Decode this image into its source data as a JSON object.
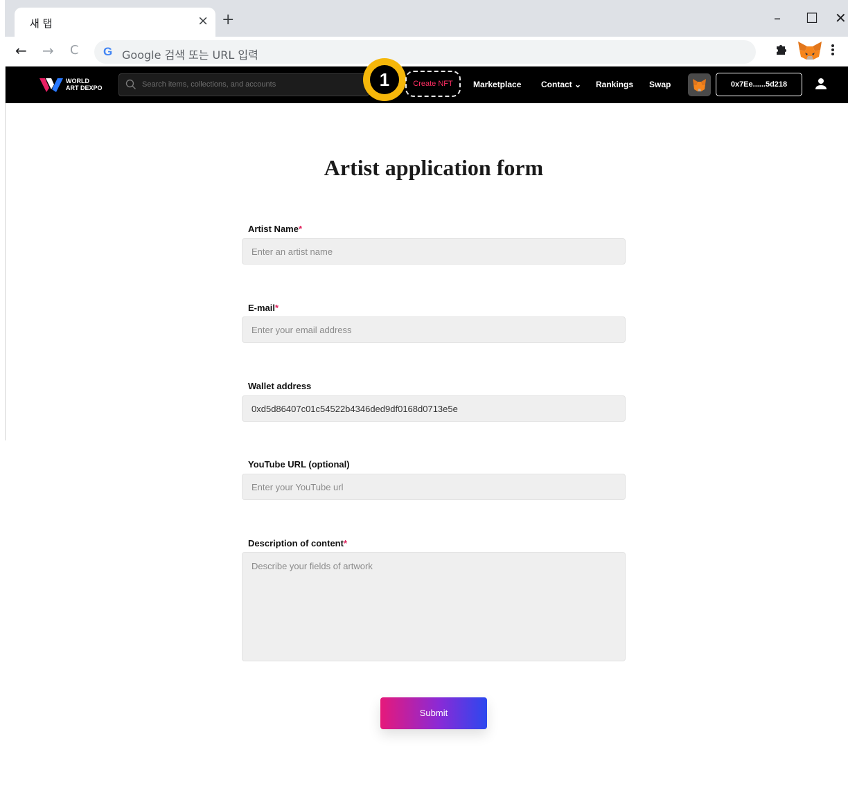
{
  "browser": {
    "tab_title": "새 탭",
    "tab_close": "×",
    "new_tab": "+",
    "omnibox_placeholder": "Google 검색 또는 URL 입력",
    "minimize": "–",
    "maximize": "☐",
    "close": "✕",
    "back": "←",
    "forward": "→",
    "reload": "C",
    "google_icon": "G"
  },
  "site_nav": {
    "logo_line1": "WORLD",
    "logo_line2": "ART DEXPO",
    "search_placeholder": "Search items, collections, and accounts",
    "step_badge": "1",
    "create_nft": "Create NFT",
    "items": [
      "Marketplace",
      "Contact ⌄",
      "Rankings",
      "Swap"
    ],
    "wallet": "0x7Ee......5d218"
  },
  "form": {
    "title": "Artist application form",
    "required_mark": "*",
    "artist_name_label": "Artist Name",
    "artist_name_placeholder": "Enter an artist name",
    "email_label": "E-mail",
    "email_placeholder": "Enter your email address",
    "wallet_label": "Wallet address",
    "wallet_value": "0xd5d86407c01c54522b4346ded9df0168d0713e5e",
    "youtube_label": "YouTube URL (optional)",
    "youtube_placeholder": "Enter your YouTube url",
    "description_label": "Description of content",
    "description_placeholder": "Describe your fields of artwork",
    "submit": "Submit"
  },
  "colors": {
    "accent_pink": "#ff2e63",
    "badge_yellow": "#f5b70a",
    "submit_gradient_start": "#e6197a",
    "submit_gradient_end": "#2b48ef"
  }
}
